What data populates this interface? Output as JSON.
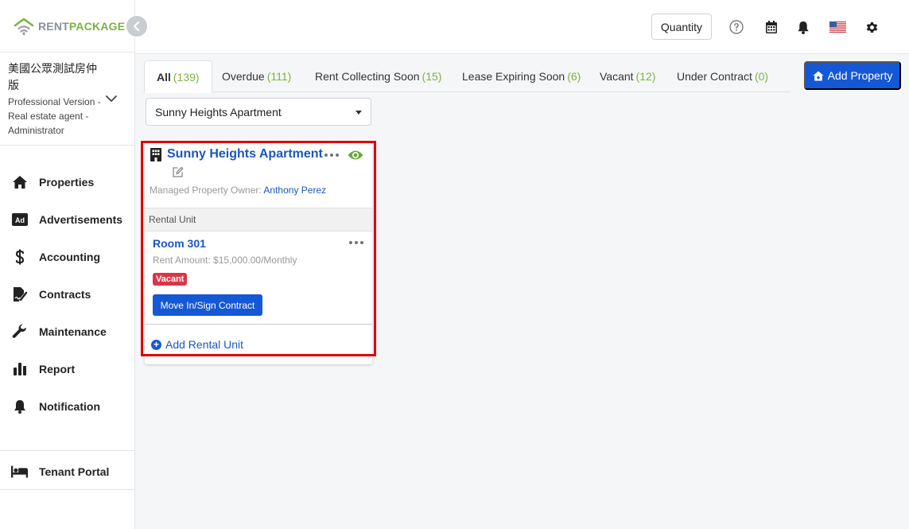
{
  "brand": {
    "logo_rent": "RENT",
    "logo_package": "PACKAGE"
  },
  "account": {
    "name": "美國公眾測試房仲版",
    "role": "Professional Version - Real estate agent - Administrator"
  },
  "nav": [
    {
      "label": "Properties",
      "icon": "home-icon"
    },
    {
      "label": "Advertisements",
      "icon": "ad-icon"
    },
    {
      "label": "Accounting",
      "icon": "dollar-icon"
    },
    {
      "label": "Contracts",
      "icon": "contract-icon"
    },
    {
      "label": "Maintenance",
      "icon": "wrench-icon"
    },
    {
      "label": "Report",
      "icon": "bar-chart-icon"
    },
    {
      "label": "Notification",
      "icon": "bell-icon"
    }
  ],
  "tenant_portal": {
    "label": "Tenant Portal",
    "icon": "bed-icon"
  },
  "header": {
    "quantity_label": "Quantity"
  },
  "tabs": [
    {
      "label": "All",
      "count": "(139)"
    },
    {
      "label": "Overdue",
      "count": "(111)"
    },
    {
      "label": "Rent Collecting Soon",
      "count": "(15)"
    },
    {
      "label": "Lease Expiring Soon",
      "count": "(6)"
    },
    {
      "label": "Vacant",
      "count": "(12)"
    },
    {
      "label": "Under Contract",
      "count": "(0)"
    }
  ],
  "add_property_label": "Add Property",
  "property_select": {
    "value": "Sunny Heights Apartment"
  },
  "property_card": {
    "title": "Sunny Heights Apartment",
    "owner_label": "Managed Property Owner:",
    "owner_name": "Anthony Perez",
    "rental_unit_header": "Rental Unit",
    "unit": {
      "name": "Room 301",
      "rent": "Rent Amount: $15,000.00/Monthly",
      "status": "Vacant",
      "action_label": "Move In/Sign Contract"
    },
    "add_unit_label": "Add Rental Unit"
  },
  "colors": {
    "primary": "#1558d6",
    "link": "#1a56c2",
    "brand_green": "#7cb342",
    "vacant_red": "#dc3545",
    "highlight": "#e00000"
  }
}
